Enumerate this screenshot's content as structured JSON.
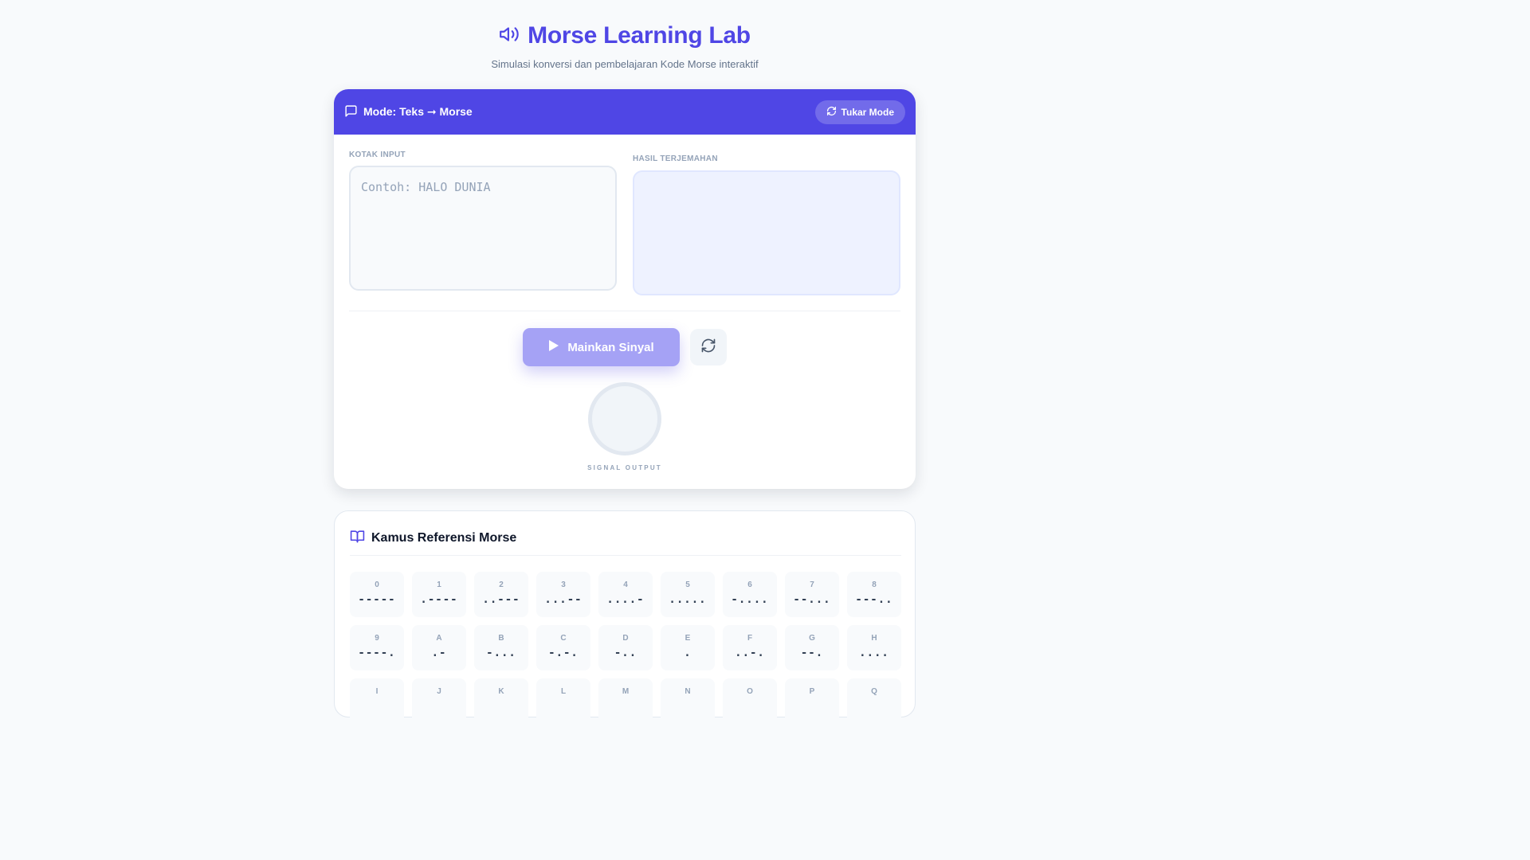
{
  "header": {
    "title": "Morse Learning Lab",
    "subtitle": "Simulasi konversi dan pembelajaran Kode Morse interaktif",
    "icon": "speaker-icon"
  },
  "colors": {
    "accent": "#4f46e5",
    "play_button": "#a5a2f5",
    "output_bg": "#eef2ff"
  },
  "converter": {
    "mode_label": "Mode: Teks ➞ Morse",
    "swap_button": "Tukar Mode",
    "input_label": "KOTAK INPUT",
    "input_placeholder": "Contoh: HALO DUNIA",
    "input_value": "",
    "output_label": "HASIL TERJEMAHAN",
    "output_value": "",
    "play_button": "Mainkan Sinyal",
    "signal_label": "SIGNAL OUTPUT"
  },
  "dictionary": {
    "title": "Kamus Referensi Morse",
    "entries": [
      {
        "char": "0",
        "code": "-----"
      },
      {
        "char": "1",
        "code": ".----"
      },
      {
        "char": "2",
        "code": "..---"
      },
      {
        "char": "3",
        "code": "...--"
      },
      {
        "char": "4",
        "code": "....-"
      },
      {
        "char": "5",
        "code": "....."
      },
      {
        "char": "6",
        "code": "-...."
      },
      {
        "char": "7",
        "code": "--..."
      },
      {
        "char": "8",
        "code": "---.."
      },
      {
        "char": "9",
        "code": "----."
      },
      {
        "char": "A",
        "code": ".-"
      },
      {
        "char": "B",
        "code": "-..."
      },
      {
        "char": "C",
        "code": "-.-."
      },
      {
        "char": "D",
        "code": "-.."
      },
      {
        "char": "E",
        "code": "."
      },
      {
        "char": "F",
        "code": "..-."
      },
      {
        "char": "G",
        "code": "--."
      },
      {
        "char": "H",
        "code": "...."
      },
      {
        "char": "I",
        "code": ""
      },
      {
        "char": "J",
        "code": ""
      },
      {
        "char": "K",
        "code": ""
      },
      {
        "char": "L",
        "code": ""
      },
      {
        "char": "M",
        "code": ""
      },
      {
        "char": "N",
        "code": ""
      },
      {
        "char": "O",
        "code": ""
      },
      {
        "char": "P",
        "code": ""
      },
      {
        "char": "Q",
        "code": ""
      }
    ]
  }
}
